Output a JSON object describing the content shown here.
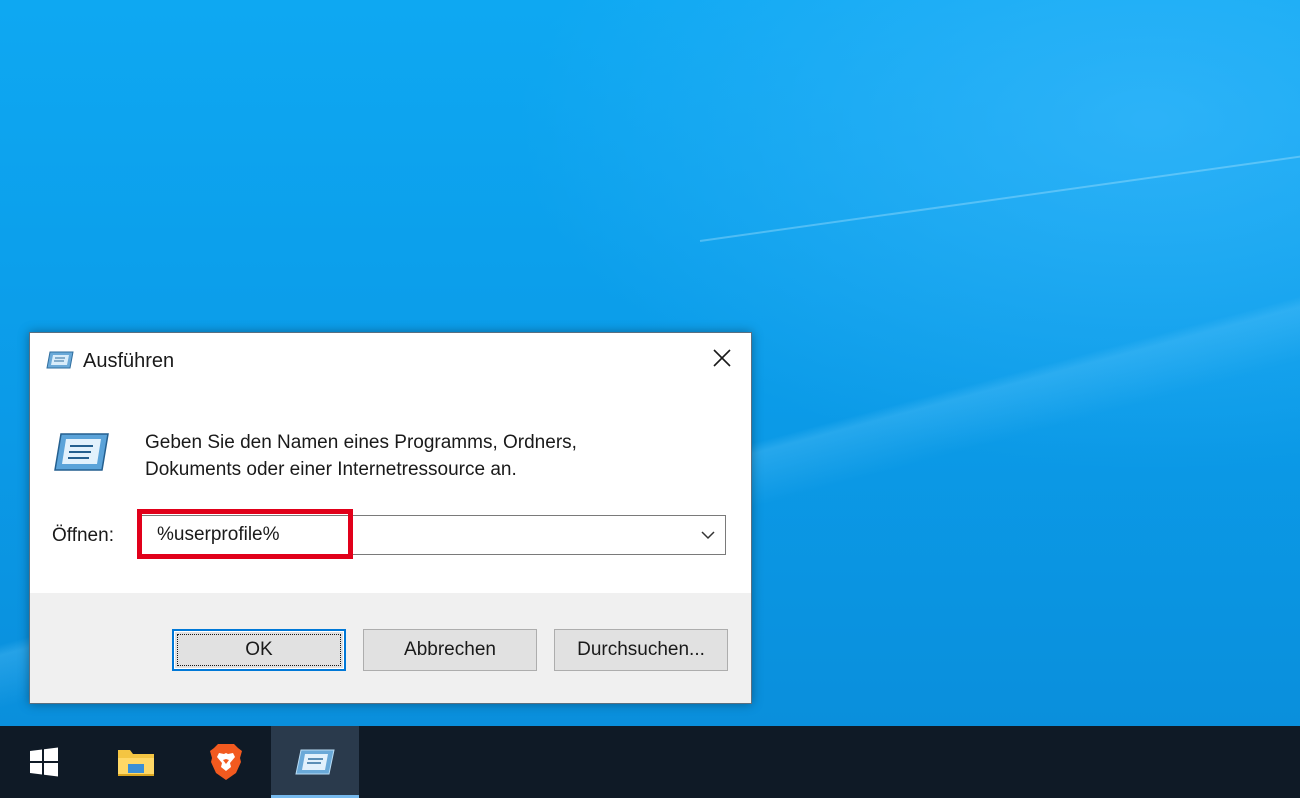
{
  "dialog": {
    "title": "Ausführen",
    "description_line1": "Geben Sie den Namen eines Programms, Ordners,",
    "description_line2": "Dokuments oder einer Internetressource an.",
    "open_label": "Öffnen:",
    "open_value": "%userprofile%",
    "buttons": {
      "ok": "OK",
      "cancel": "Abbrechen",
      "browse": "Durchsuchen..."
    }
  },
  "taskbar": {
    "items": [
      {
        "icon": "windows-start-icon"
      },
      {
        "icon": "file-explorer-icon"
      },
      {
        "icon": "brave-browser-icon"
      },
      {
        "icon": "run-dialog-icon",
        "active": true
      }
    ]
  },
  "colors": {
    "desktop": "#0a98e6",
    "taskbar": "#0f1a26",
    "highlight": "#e1001a",
    "accent": "#0078d7"
  }
}
